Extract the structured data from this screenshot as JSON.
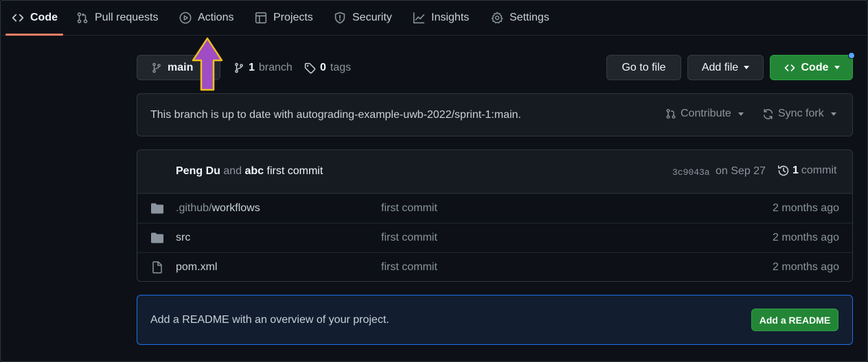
{
  "tabs": [
    {
      "label": "Code",
      "icon": "code-icon",
      "selected": true
    },
    {
      "label": "Pull requests",
      "icon": "pull-request-icon"
    },
    {
      "label": "Actions",
      "icon": "play-icon"
    },
    {
      "label": "Projects",
      "icon": "table-icon"
    },
    {
      "label": "Security",
      "icon": "shield-icon"
    },
    {
      "label": "Insights",
      "icon": "graph-icon"
    },
    {
      "label": "Settings",
      "icon": "gear-icon"
    }
  ],
  "branch_bar": {
    "current_branch": "main",
    "branch_count": "1",
    "branch_word": "branch",
    "tag_count": "0",
    "tag_word": "tags",
    "goto_file": "Go to file",
    "add_file": "Add file",
    "code": "Code"
  },
  "status": {
    "text": "This branch is up to date with autograding-example-uwb-2022/sprint-1:main.",
    "contribute": "Contribute",
    "sync_fork": "Sync fork"
  },
  "latest_commit": {
    "author1": "Peng Du",
    "and": "and",
    "author2": "abc",
    "message": "first commit",
    "sha": "3c9043a",
    "date": "on Sep 27",
    "count": "1",
    "count_word": "commit"
  },
  "files": [
    {
      "type": "folder",
      "name_prefix": ".github/",
      "name": "workflows",
      "message": "first commit",
      "age": "2 months ago"
    },
    {
      "type": "folder",
      "name_prefix": "",
      "name": "src",
      "message": "first commit",
      "age": "2 months ago"
    },
    {
      "type": "file",
      "name_prefix": "",
      "name": "pom.xml",
      "message": "first commit",
      "age": "2 months ago"
    }
  ],
  "readme": {
    "text": "Add a README with an overview of your project.",
    "button": "Add a README"
  },
  "colors": {
    "accent_tab": "#f78166",
    "green_button": "#238636",
    "arrow_fill": "#a04cc4",
    "arrow_stroke": "#f0c020",
    "link_blue": "#58a6ff"
  }
}
